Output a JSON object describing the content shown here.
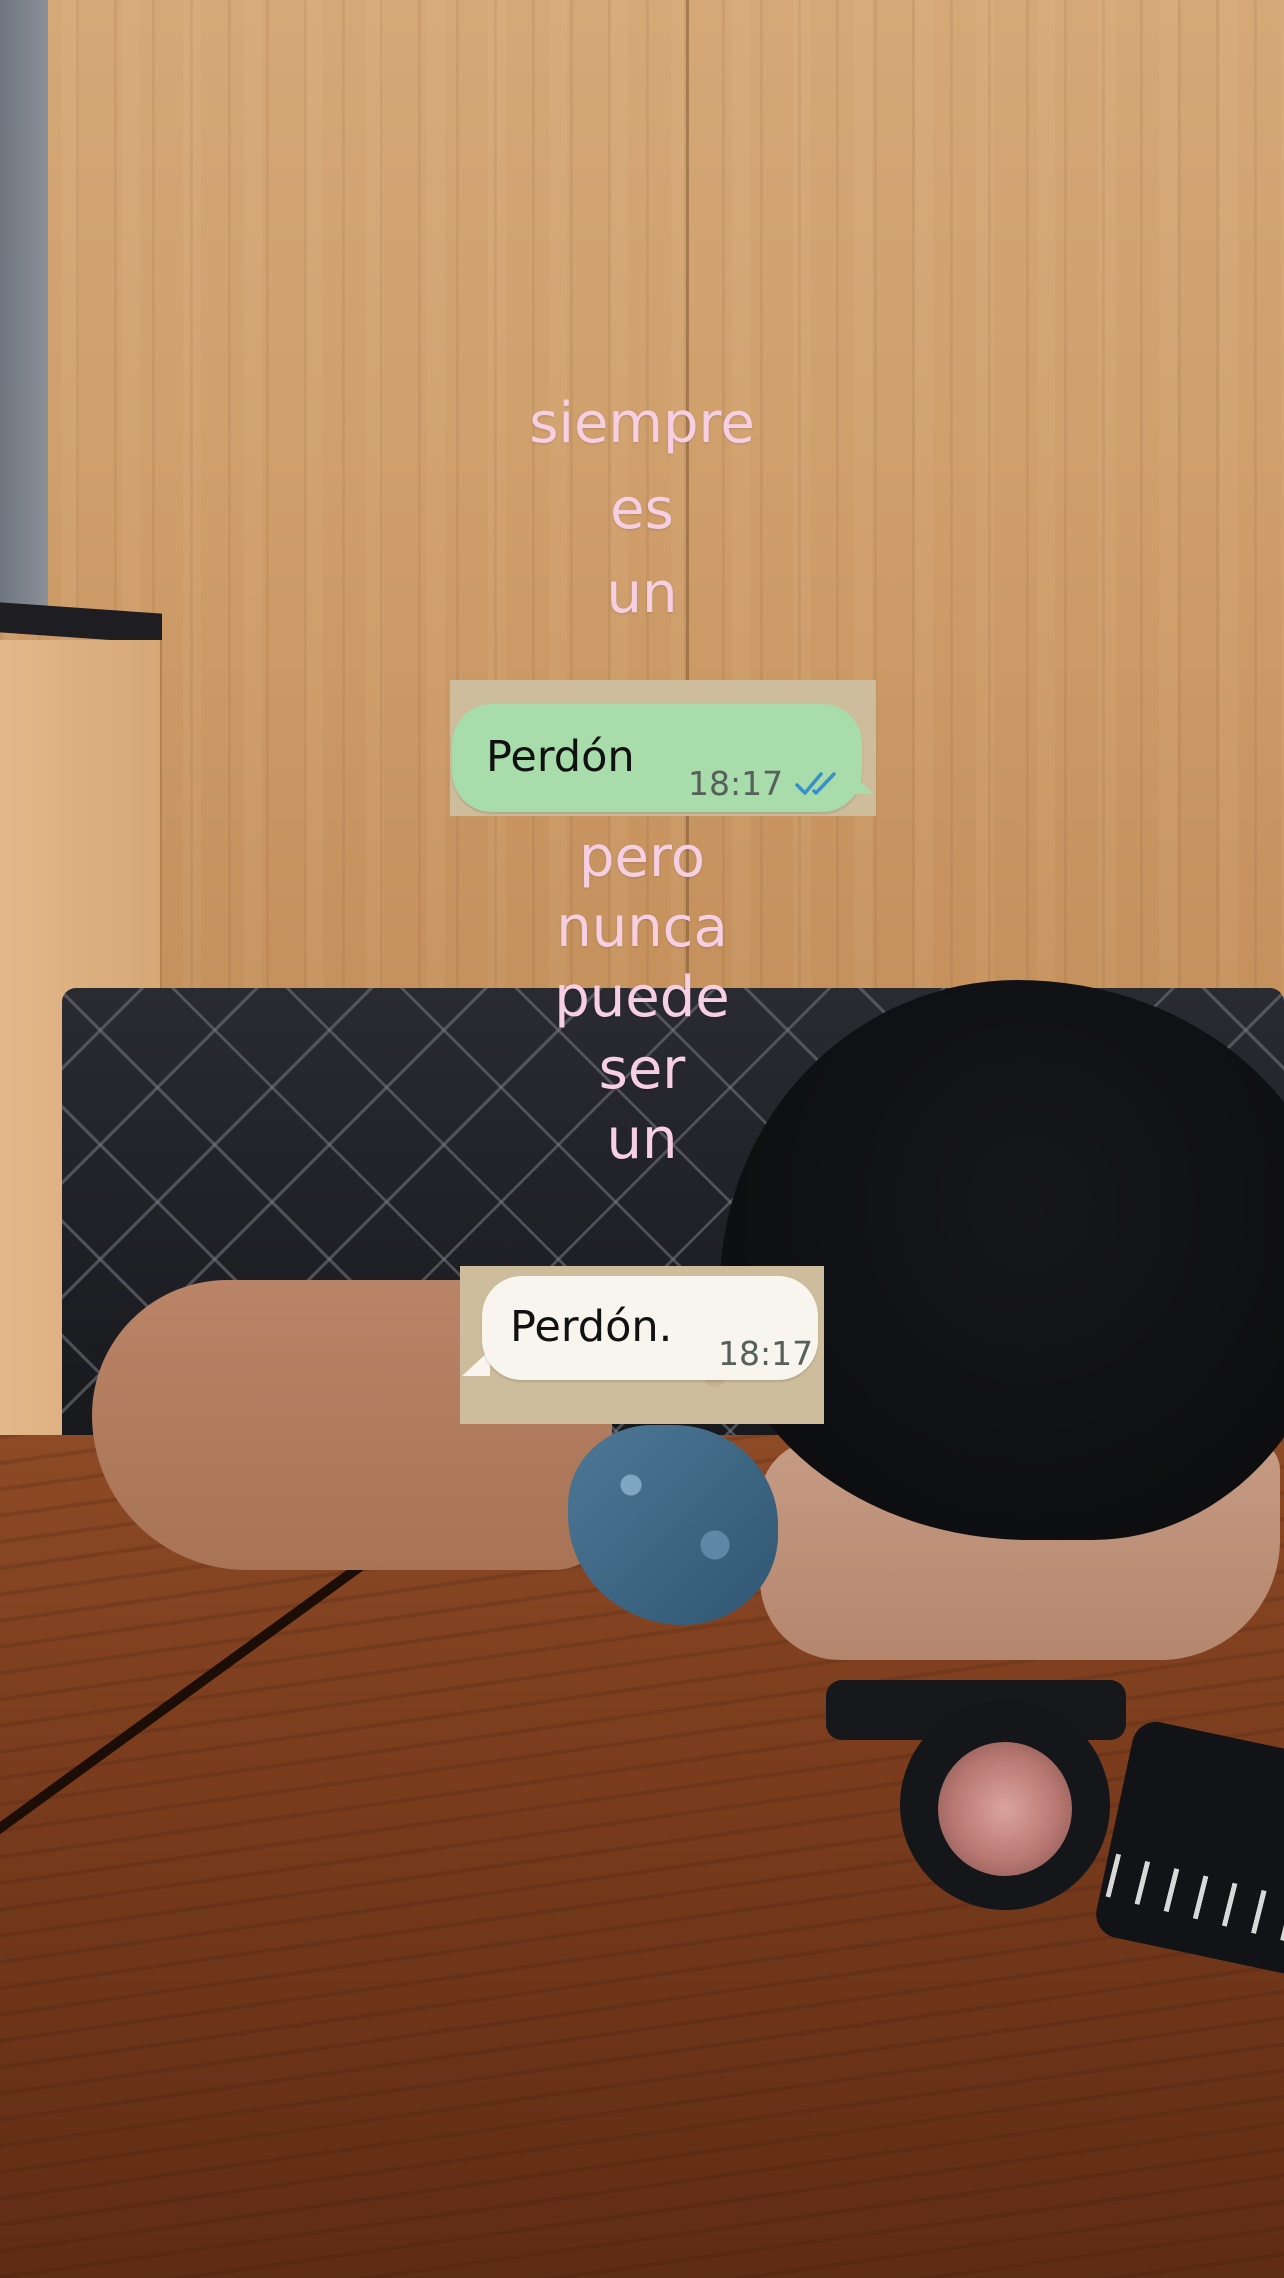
{
  "overlay_text": {
    "line1": "siempre",
    "line2": "es",
    "line3": "un",
    "line4": "pero",
    "line5": "nunca",
    "line6": "puede",
    "line7": "ser",
    "line8": "un"
  },
  "sent_message": {
    "text": "Perdón",
    "time": "18:17",
    "status_icon": "double-check-read-icon"
  },
  "received_message": {
    "text": "Perdón.",
    "time": "18:17"
  },
  "colors": {
    "overlay_text": "#f7cfe2",
    "sent_bubble": "#a8dcaa",
    "received_bubble": "#f7f5ee",
    "read_ticks": "#3b8fc9"
  }
}
